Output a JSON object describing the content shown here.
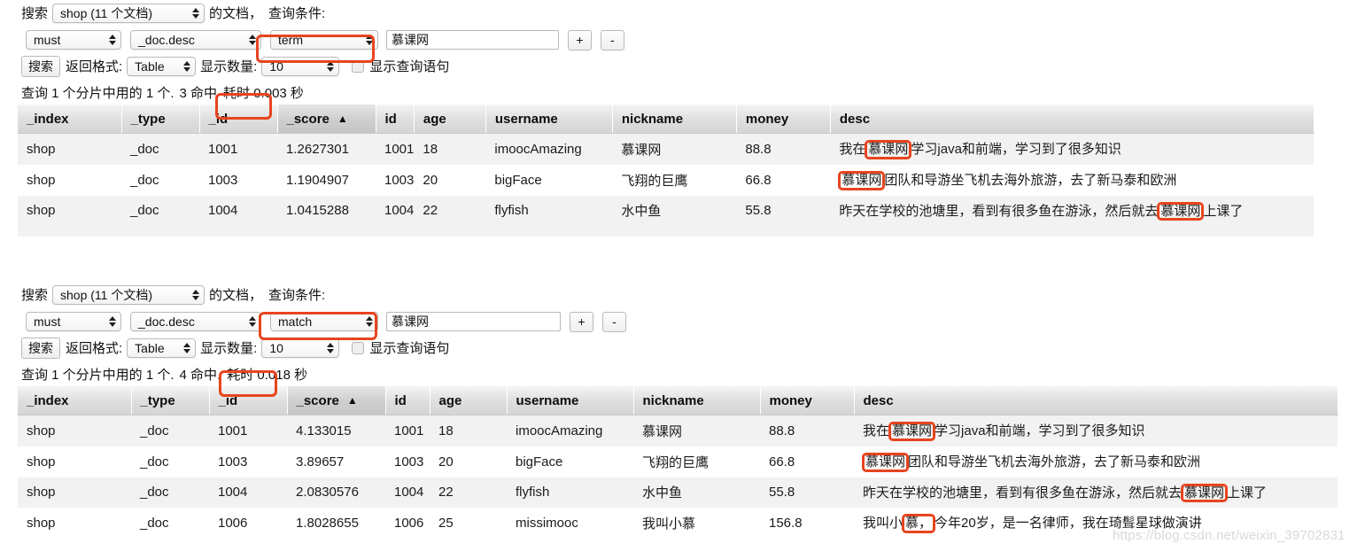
{
  "panels": [
    {
      "controls": {
        "search_label": "搜索",
        "index_select": "shop (11 个文档)",
        "of_docs_label": "的文档，",
        "query_cond_label": "查询条件:",
        "bool_select": "must",
        "field_select": "_doc.desc",
        "type_select": "term",
        "value_input": "慕课网",
        "add_button": "+",
        "remove_button": "-",
        "search_button": "搜索",
        "format_label": "返回格式:",
        "format_select": "Table",
        "size_label": "显示数量:",
        "size_select": "10",
        "show_query_label": "显示查询语句"
      },
      "summary": {
        "prefix": "查询 1 个分片中用的 1 个.",
        "hits": "3 命中",
        "suffix": "耗时 0.003 秒"
      },
      "table": {
        "columns": [
          "_index",
          "_type",
          "_id",
          "_score",
          "id",
          "age",
          "username",
          "nickname",
          "money",
          "desc"
        ],
        "sorted_column": "_score",
        "sort_direction": "▲",
        "rows": [
          {
            "_index": "shop",
            "_type": "_doc",
            "_id": "1001",
            "_score": "1.2627301",
            "id": "1001",
            "age": "18",
            "username": "imoocAmazing",
            "nickname": "慕课网",
            "money": "88.8",
            "desc_parts": [
              {
                "text": "我在",
                "highlight": false
              },
              {
                "text": "慕课网",
                "highlight": true
              },
              {
                "text": "学习java和前端，学习到了很多知识",
                "highlight": false
              }
            ]
          },
          {
            "_index": "shop",
            "_type": "_doc",
            "_id": "1003",
            "_score": "1.1904907",
            "id": "1003",
            "age": "20",
            "username": "bigFace",
            "nickname": "飞翔的巨鹰",
            "money": "66.8",
            "desc_parts": [
              {
                "text": "慕课网",
                "highlight": true
              },
              {
                "text": "团队和导游坐飞机去海外旅游，去了新马泰和欧洲",
                "highlight": false
              }
            ]
          },
          {
            "_index": "shop",
            "_type": "_doc",
            "_id": "1004",
            "_score": "1.0415288",
            "id": "1004",
            "age": "22",
            "username": "flyfish",
            "nickname": "水中鱼",
            "money": "55.8",
            "desc_parts": [
              {
                "text": "昨天在学校的池塘里，看到有很多鱼在游泳，然后就去",
                "highlight": false
              },
              {
                "text": "慕课网",
                "highlight": true
              },
              {
                "text": "上课了",
                "highlight": false
              }
            ]
          }
        ]
      }
    },
    {
      "controls": {
        "search_label": "搜索",
        "index_select": "shop (11 个文档)",
        "of_docs_label": "的文档，",
        "query_cond_label": "查询条件:",
        "bool_select": "must",
        "field_select": "_doc.desc",
        "type_select": "match",
        "value_input": "慕课网",
        "add_button": "+",
        "remove_button": "-",
        "search_button": "搜索",
        "format_label": "返回格式:",
        "format_select": "Table",
        "size_label": "显示数量:",
        "size_select": "10",
        "show_query_label": "显示查询语句"
      },
      "summary": {
        "prefix": "查询 1 个分片中用的 1 个.",
        "hits": "4 命中.",
        "suffix": "耗时 0.018 秒"
      },
      "table": {
        "columns": [
          "_index",
          "_type",
          "_id",
          "_score",
          "id",
          "age",
          "username",
          "nickname",
          "money",
          "desc"
        ],
        "sorted_column": "_score",
        "sort_direction": "▲",
        "rows": [
          {
            "_index": "shop",
            "_type": "_doc",
            "_id": "1001",
            "_score": "4.133015",
            "id": "1001",
            "age": "18",
            "username": "imoocAmazing",
            "nickname": "慕课网",
            "money": "88.8",
            "desc_parts": [
              {
                "text": "我在",
                "highlight": false
              },
              {
                "text": "慕课网",
                "highlight": true
              },
              {
                "text": "学习java和前端，学习到了很多知识",
                "highlight": false
              }
            ]
          },
          {
            "_index": "shop",
            "_type": "_doc",
            "_id": "1003",
            "_score": "3.89657",
            "id": "1003",
            "age": "20",
            "username": "bigFace",
            "nickname": "飞翔的巨鹰",
            "money": "66.8",
            "desc_parts": [
              {
                "text": "慕课网",
                "highlight": true
              },
              {
                "text": "团队和导游坐飞机去海外旅游，去了新马泰和欧洲",
                "highlight": false
              }
            ]
          },
          {
            "_index": "shop",
            "_type": "_doc",
            "_id": "1004",
            "_score": "2.0830576",
            "id": "1004",
            "age": "22",
            "username": "flyfish",
            "nickname": "水中鱼",
            "money": "55.8",
            "desc_parts": [
              {
                "text": "昨天在学校的池塘里，看到有很多鱼在游泳，然后就去",
                "highlight": false
              },
              {
                "text": "慕课网",
                "highlight": true
              },
              {
                "text": "上课了",
                "highlight": false
              }
            ]
          },
          {
            "_index": "shop",
            "_type": "_doc",
            "_id": "1006",
            "_score": "1.8028655",
            "id": "1006",
            "age": "25",
            "username": "missimooc",
            "nickname": "我叫小慕",
            "money": "156.8",
            "desc_parts": [
              {
                "text": "我叫小",
                "highlight": false
              },
              {
                "text": "慕，",
                "highlight": true
              },
              {
                "text": "今年20岁，是一名律师，我在琦髶星球做演讲",
                "highlight": false
              }
            ]
          }
        ]
      }
    }
  ],
  "watermark": "https://blog.csdn.net/weixin_39702831",
  "colors": {
    "annotation": "#e8441f",
    "header_bg": "#dfdfdf",
    "row_stripe": "#f2f2f2"
  }
}
